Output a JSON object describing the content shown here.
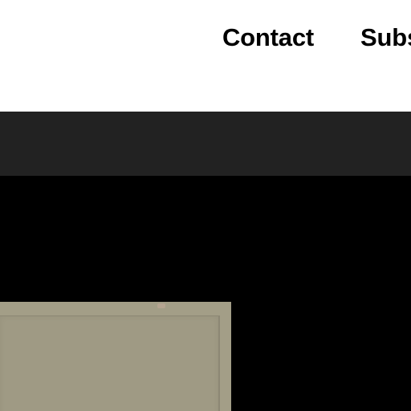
{
  "nav": {
    "items": [
      {
        "label": "Contact"
      },
      {
        "label": "Subs"
      }
    ]
  },
  "colors": {
    "nav_bg": "#ffffff",
    "sub_bar_bg": "#222222",
    "media_bg": "#000000",
    "photo_bg": "#a39e87"
  }
}
